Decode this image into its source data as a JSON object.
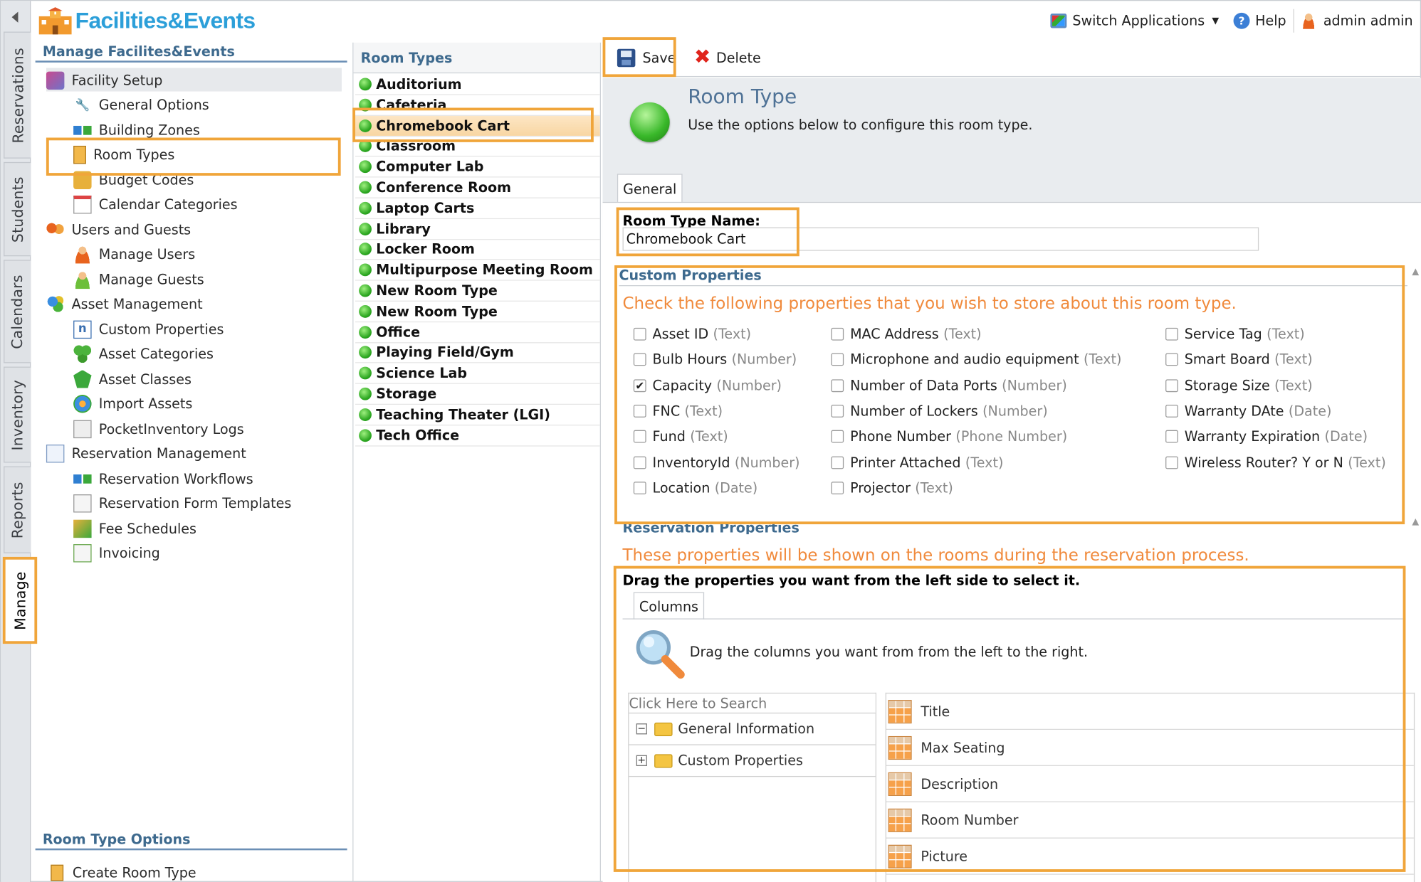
{
  "app": {
    "title": "Facilities&Events"
  },
  "header": {
    "switch_applications": "Switch Applications",
    "help": "Help",
    "user": "admin admin"
  },
  "vtabs": [
    "Reservations",
    "Students",
    "Calendars",
    "Inventory",
    "Reports",
    "Manage"
  ],
  "sidebar": {
    "heading": "Manage Facilites&Events",
    "groups": [
      {
        "label": "Facility Setup",
        "icon": "facility-icon",
        "items": [
          {
            "label": "General Options",
            "icon": "wrench-icon"
          },
          {
            "label": "Building Zones",
            "icon": "zones-icon"
          },
          {
            "label": "Room Types",
            "icon": "door-icon"
          },
          {
            "label": "Budget Codes",
            "icon": "budget-icon"
          },
          {
            "label": "Calendar Categories",
            "icon": "calendar-icon"
          }
        ]
      },
      {
        "label": "Users and Guests",
        "icon": "users-icon",
        "items": [
          {
            "label": "Manage Users",
            "icon": "user-icon"
          },
          {
            "label": "Manage Guests",
            "icon": "guest-icon"
          }
        ]
      },
      {
        "label": "Asset Management",
        "icon": "asset-icon",
        "items": [
          {
            "label": "Custom Properties",
            "icon": "custom-properties-icon"
          },
          {
            "label": "Asset Categories",
            "icon": "asset-categories-icon"
          },
          {
            "label": "Asset Classes",
            "icon": "asset-classes-icon"
          },
          {
            "label": "Import Assets",
            "icon": "import-icon"
          },
          {
            "label": "PocketInventory Logs",
            "icon": "logs-icon"
          }
        ]
      },
      {
        "label": "Reservation Management",
        "icon": "reservation-icon",
        "items": [
          {
            "label": "Reservation Workflows",
            "icon": "workflow-icon"
          },
          {
            "label": "Reservation Form Templates",
            "icon": "form-icon"
          },
          {
            "label": "Fee Schedules",
            "icon": "fee-icon"
          },
          {
            "label": "Invoicing",
            "icon": "invoice-icon"
          }
        ]
      }
    ],
    "options_heading": "Room Type Options",
    "create_room_type": "Create Room Type"
  },
  "room_types": {
    "heading": "Room Types",
    "selected": "Chromebook Cart",
    "items": [
      "Auditorium",
      "Cafeteria",
      "Chromebook Cart",
      "Classroom",
      "Computer Lab",
      "Conference Room",
      "Laptop Carts",
      "Library",
      "Locker Room",
      "Multipurpose Meeting Room",
      "New Room Type",
      "New Room Type",
      "Office",
      "Playing Field/Gym",
      "Science Lab",
      "Storage",
      "Teaching Theater (LGI)",
      "Tech Office"
    ]
  },
  "toolbar": {
    "save": "Save",
    "delete": "Delete"
  },
  "form": {
    "title": "Room Type",
    "subtitle": "Use the options below to configure this room type.",
    "tab": "General",
    "name_label": "Room Type Name:",
    "name_value": "Chromebook Cart"
  },
  "custom_properties": {
    "heading": "Custom Properties",
    "instruction": "Check the following properties that you wish to store about this room type.",
    "columns": [
      [
        {
          "name": "Asset ID",
          "type": "(Text)",
          "checked": false
        },
        {
          "name": "Bulb Hours",
          "type": "(Number)",
          "checked": false
        },
        {
          "name": "Capacity",
          "type": "(Number)",
          "checked": true
        },
        {
          "name": "FNC",
          "type": "(Text)",
          "checked": false
        },
        {
          "name": "Fund",
          "type": "(Text)",
          "checked": false
        },
        {
          "name": "InventoryId",
          "type": "(Number)",
          "checked": false
        },
        {
          "name": "Location",
          "type": "(Date)",
          "checked": false
        }
      ],
      [
        {
          "name": "MAC Address",
          "type": "(Text)",
          "checked": false
        },
        {
          "name": "Microphone and audio equipment",
          "type": "(Text)",
          "checked": false
        },
        {
          "name": "Number of Data Ports",
          "type": "(Number)",
          "checked": false
        },
        {
          "name": "Number of Lockers",
          "type": "(Number)",
          "checked": false
        },
        {
          "name": "Phone Number",
          "type": "(Phone Number)",
          "checked": false
        },
        {
          "name": "Printer Attached",
          "type": "(Text)",
          "checked": false
        },
        {
          "name": "Projector",
          "type": "(Text)",
          "checked": false
        }
      ],
      [
        {
          "name": "Service Tag",
          "type": "(Text)",
          "checked": false
        },
        {
          "name": "Smart Board",
          "type": "(Text)",
          "checked": false
        },
        {
          "name": "Storage Size",
          "type": "(Text)",
          "checked": false
        },
        {
          "name": "Warranty DAte",
          "type": "(Date)",
          "checked": false
        },
        {
          "name": "Warranty Expiration",
          "type": "(Date)",
          "checked": false
        },
        {
          "name": "Wireless Router? Y or N",
          "type": "(Text)",
          "checked": false
        }
      ]
    ]
  },
  "reservation_properties": {
    "heading": "Reservation Properties",
    "instruction": "These properties will be shown on the rooms during the reservation process.",
    "drag_instruction": "Drag the properties you want from the left side to select it.",
    "tab": "Columns",
    "drag_columns_text": "Drag the columns you want from from the left to the right.",
    "search_placeholder": "Click Here to Search",
    "tree": [
      {
        "label": "General Information",
        "expander": "−"
      },
      {
        "label": "Custom Properties",
        "expander": "+"
      }
    ],
    "selected_columns": [
      "Title",
      "Max Seating",
      "Description",
      "Room Number",
      "Picture"
    ]
  },
  "colors": {
    "accent": "#f0a53a",
    "heading_blue": "#3e6a8e",
    "instruction_orange": "#f08a3c",
    "status_green": "#2aa51f"
  }
}
